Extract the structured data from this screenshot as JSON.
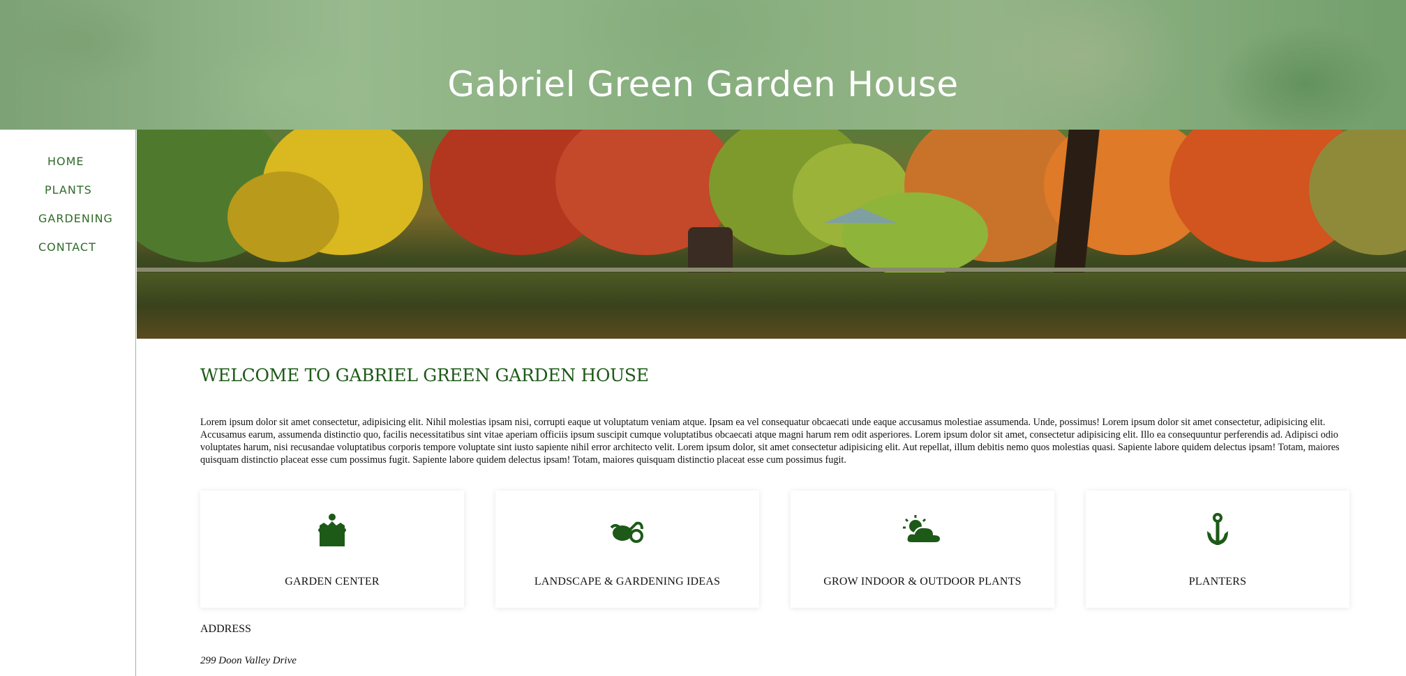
{
  "header": {
    "title": "Gabriel Green Garden House"
  },
  "nav": {
    "items": [
      {
        "label": "HOME"
      },
      {
        "label": "PLANTS"
      },
      {
        "label": "GARDENING"
      },
      {
        "label": "CONTACT"
      }
    ]
  },
  "main": {
    "heading": "WELCOME TO GABRIEL GREEN GARDEN HOUSE",
    "intro": "Lorem ipsum dolor sit amet consectetur, adipisicing elit. Nihil molestias ipsam nisi, corrupti eaque ut voluptatum veniam atque. Ipsam ea vel consequatur obcaecati unde eaque accusamus molestiae assumenda. Unde, possimus! Lorem ipsum dolor sit amet consectetur, adipisicing elit. Accusamus earum, assumenda distinctio quo, facilis necessitatibus sint vitae aperiam officiis ipsum suscipit cumque voluptatibus obcaecati atque magni harum rem odit asperiores. Lorem ipsum dolor sit amet, consectetur adipisicing elit. Illo ea consequuntur perferendis ad. Adipisci odio voluptates harum, nisi recusandae voluptatibus corporis tempore voluptate sint iusto sapiente nihil error architecto velit. Lorem ipsum dolor, sit amet consectetur adipisicing elit. Aut repellat, illum debitis nemo quos molestias quasi. Sapiente labore quidem delectus ipsam! Totam, maiores quisquam distinctio placeat esse cum possimus fugit. Sapiente labore quidem delectus ipsam! Totam, maiores quisquam distinctio placeat esse cum possimus fugit.",
    "cards": [
      {
        "label": "GARDEN CENTER",
        "icon": "crown-icon"
      },
      {
        "label": "LANDSCAPE & GARDENING IDEAS",
        "icon": "watering-can-icon"
      },
      {
        "label": "GROW INDOOR & OUTDOOR PLANTS",
        "icon": "cloud-sun-icon"
      },
      {
        "label": "PLANTERS",
        "icon": "anchor-icon"
      }
    ],
    "address_heading": "ADDRESS",
    "address_line": "299 Doon Valley Drive"
  },
  "colors": {
    "accent": "#1d5a18",
    "nav_text": "#2f6b2a",
    "sidebar_border": "#8fc18a"
  }
}
